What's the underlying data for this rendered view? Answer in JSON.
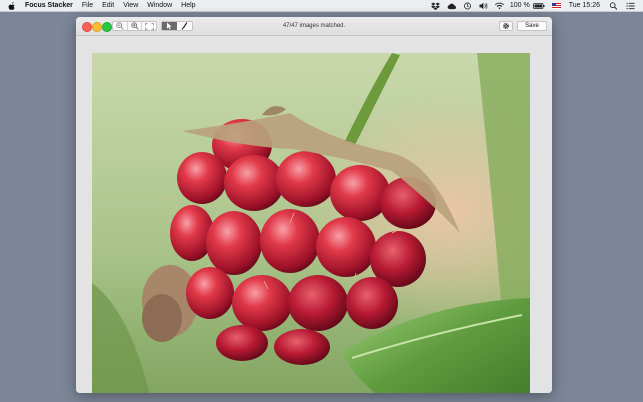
{
  "menubar": {
    "apple_icon": "apple-logo-icon",
    "app_name": "Focus Stacker",
    "items": [
      "File",
      "Edit",
      "View",
      "Window",
      "Help"
    ],
    "status_icons": [
      "dropbox-icon",
      "cloud-icon",
      "time-machine-icon",
      "volume-icon",
      "wifi-icon"
    ],
    "battery_percent": "100 %",
    "clock": "Tue 15:26",
    "spotlight_icon": "search-icon",
    "notification_icon": "list-icon"
  },
  "window": {
    "status_text": "47/47 images matched.",
    "save_label": "Save",
    "tools": {
      "zoom_out_icon": "zoom-out-icon",
      "zoom_in_icon": "zoom-in-icon",
      "zoom_fit_icon": "zoom-fit-icon",
      "select_icon": "pointer-icon",
      "brush_icon": "brush-icon",
      "settings_icon": "gear-icon"
    }
  },
  "image": {
    "subject": "raspberry on stem macro photo"
  },
  "colors": {
    "desktop": "#7c8698",
    "close": "#fc5f57",
    "minimize": "#fdbc2e",
    "zoom": "#28c840",
    "active_tool": "#6b6b6b"
  }
}
